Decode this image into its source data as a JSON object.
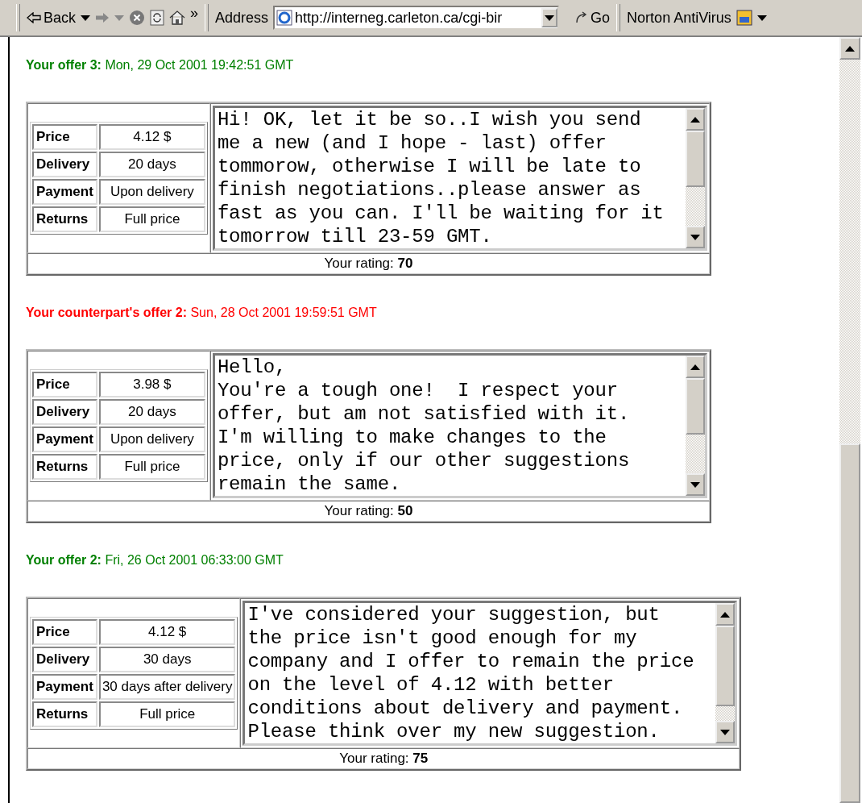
{
  "toolbar": {
    "back": "Back",
    "more": "»",
    "address_label": "Address",
    "url": "http://interneg.carleton.ca/cgi-bir",
    "go": "Go",
    "extension": "Norton AntiVirus"
  },
  "offers": [
    {
      "title": "Your offer 3:",
      "time": "Mon, 29 Oct 2001 19:42:51 GMT",
      "color": "#008000",
      "terms": [
        {
          "label": "Price",
          "value": "4.12 $"
        },
        {
          "label": "Delivery",
          "value": "20 days"
        },
        {
          "label": "Payment",
          "value": "Upon delivery"
        },
        {
          "label": "Returns",
          "value": "Full price"
        }
      ],
      "message": "Hi! OK, let it be so..I wish you send\nme a new (and I hope - last) offer\ntommorow, otherwise I will be late to\nfinish negotiations..please answer as\nfast as you can. I'll be waiting for it\ntomorrow till 23-59 GMT.",
      "rating_label": "Your rating:",
      "rating": "70"
    },
    {
      "title": "Your counterpart's offer 2:",
      "time": "Sun, 28 Oct 2001 19:59:51 GMT",
      "color": "#ff0000",
      "terms": [
        {
          "label": "Price",
          "value": "3.98 $"
        },
        {
          "label": "Delivery",
          "value": "20 days"
        },
        {
          "label": "Payment",
          "value": "Upon delivery"
        },
        {
          "label": "Returns",
          "value": "Full price"
        }
      ],
      "message": "Hello,\nYou're a tough one!  I respect your\noffer, but am not satisfied with it.\nI'm willing to make changes to the\nprice, only if our other suggestions\nremain the same.",
      "rating_label": "Your rating:",
      "rating": "50"
    },
    {
      "title": "Your offer 2:",
      "time": "Fri, 26 Oct 2001 06:33:00 GMT",
      "color": "#008000",
      "terms": [
        {
          "label": "Price",
          "value": "4.12 $"
        },
        {
          "label": "Delivery",
          "value": "30 days"
        },
        {
          "label": "Payment",
          "value": "30 days after delivery"
        },
        {
          "label": "Returns",
          "value": "Full price"
        }
      ],
      "message": "I've considered your suggestion, but\nthe price isn't good enough for my\ncompany and I offer to remain the price\non the level of 4.12 with better\nconditions about delivery and payment.\nPlease think over my new suggestion.",
      "rating_label": "Your rating:",
      "rating": "75"
    }
  ]
}
